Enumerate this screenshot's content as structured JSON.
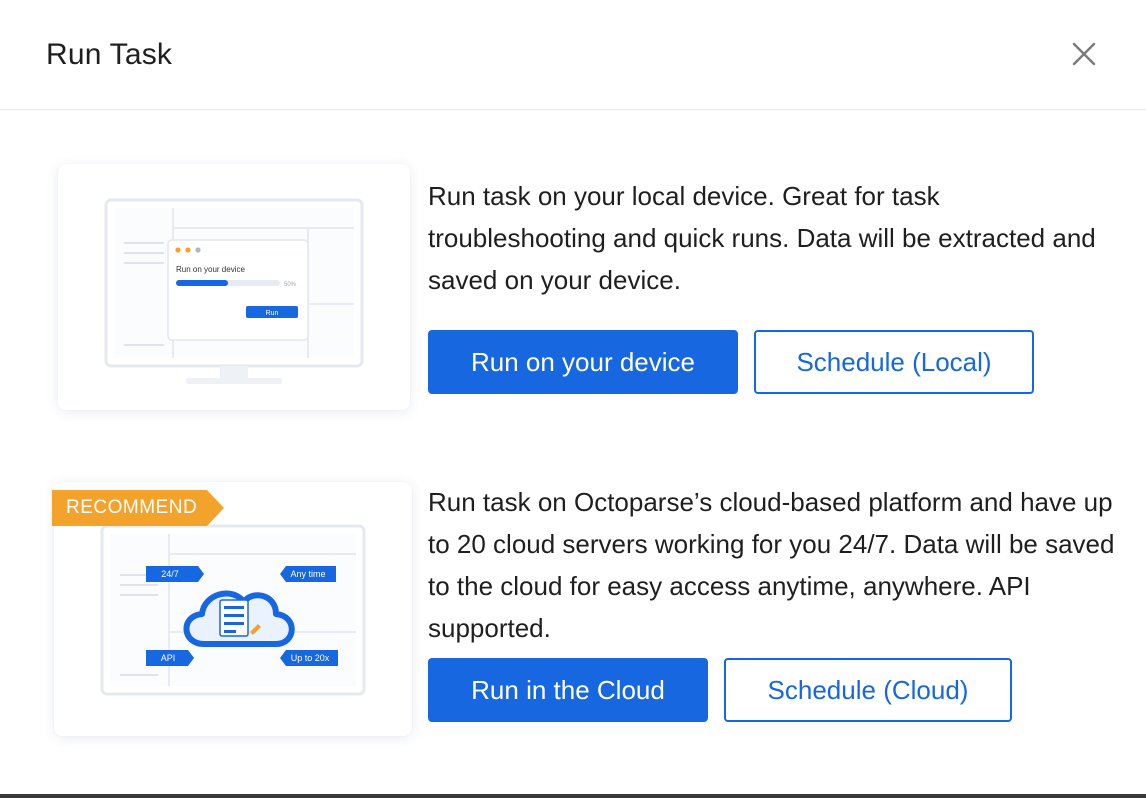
{
  "dialog": {
    "title": "Run Task"
  },
  "local": {
    "description": "Run task on your local device. Great for task troubleshooting and quick runs. Data will be extracted and saved on your device.",
    "primary_label": "Run on your device",
    "secondary_label": "Schedule (Local)",
    "illustration": {
      "dialog_title": "Run on your device",
      "progress_text": "50%",
      "progress": 0.5,
      "run_label": "Run"
    }
  },
  "cloud": {
    "badge": "RECOMMEND",
    "description": "Run task on Octoparse’s cloud-based platform and have up to 20 cloud servers working for you 24/7. Data will be saved to the cloud for easy access anytime, anywhere. API supported.",
    "primary_label": "Run in the Cloud",
    "secondary_label": "Schedule (Cloud)",
    "illustration": {
      "tag_top_left": "24/7",
      "tag_top_right": "Any time",
      "tag_bottom_left": "API",
      "tag_bottom_right": "Up to 20x"
    }
  },
  "colors": {
    "primary": "#1767e0",
    "badge": "#f3a32c"
  }
}
